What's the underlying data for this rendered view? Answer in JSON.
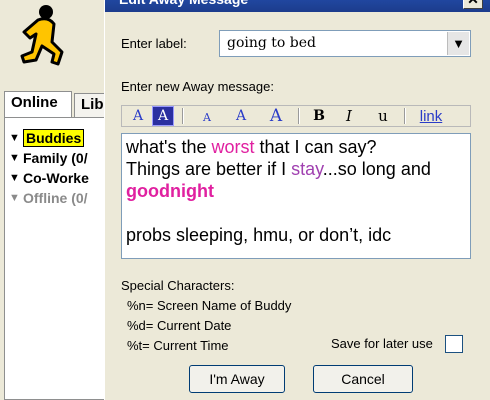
{
  "buddy_list": {
    "tabs": [
      "Online",
      "Lib"
    ],
    "groups": [
      {
        "name": "Buddies",
        "tri": "▼"
      },
      {
        "name": "Family (0/",
        "tri": "▼"
      },
      {
        "name": "Co-Worke",
        "tri": "▼"
      },
      {
        "name": "Offline (0/",
        "tri": "▼"
      }
    ]
  },
  "dialog": {
    "title": "Edit Away Message",
    "close_glyph": "✕",
    "label_caption": "Enter label:",
    "label_value": "going to bed",
    "label_arrow": "▼",
    "message_caption": "Enter new Away message:",
    "toolbar": {
      "font_color": "A",
      "background_color": "A",
      "smaller": "A",
      "normal": "A",
      "larger": "A",
      "bold": "B",
      "italic": "I",
      "underline": "u",
      "link": "link"
    },
    "message": {
      "line1_a": "what's the ",
      "line1_b": "worst",
      "line1_c": " that I can say?",
      "line2_a": "Things are better if I ",
      "line2_b": "stay",
      "line2_c": "...so long and",
      "line3": "goodnight",
      "line4": "probs sleeping, hmu, or don’t, idc"
    },
    "special": {
      "heading": "Special Characters:",
      "items": [
        "%n= Screen Name of Buddy",
        "%d= Current Date",
        "%t= Current Time"
      ]
    },
    "save_caption": "Save for later use",
    "save_checked": false,
    "buttons": {
      "im_away": "I'm Away",
      "cancel": "Cancel"
    },
    "colors": {
      "pink": "#e020a0",
      "purple": "#a040b0",
      "toolbar_blue": "#2a3cc8",
      "title_blue": "#2450b0"
    }
  }
}
